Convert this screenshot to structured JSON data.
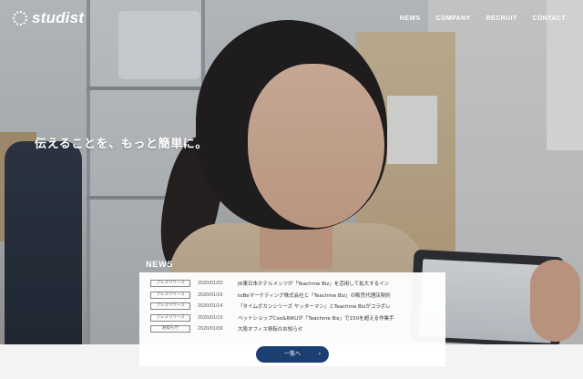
{
  "brand": {
    "logo_text": "studist"
  },
  "nav": {
    "items": [
      "NEWS",
      "COMPANY",
      "RECRUIT",
      "CONTACT"
    ]
  },
  "hero": {
    "tagline": "伝えることを、もっと簡単に。"
  },
  "news": {
    "heading": "NEWS",
    "items": [
      {
        "category": "プレスリリース",
        "date": "2020/01/20",
        "title": "JR東日本ホテルメッツが「Teachme Biz」を活用して拡大するイン"
      },
      {
        "category": "プレスリリース",
        "date": "2020/01/16",
        "title": "toBeマーケティング株式会社と「Teachme Biz」の販売代理店契約"
      },
      {
        "category": "プレスリリース",
        "date": "2020/01/14",
        "title": "『タイムボカンシリーズ ヤッターマン』とTeachme Bizがコラボレ"
      },
      {
        "category": "プレスリリース",
        "date": "2020/01/10",
        "title": "ペットショップCoo&RIKUが「Teachme Biz」で150を超える作業手"
      },
      {
        "category": "お知らせ",
        "date": "2020/01/09",
        "title": "大阪オフィス移転のお知らせ"
      }
    ],
    "more_label": "一覧へ",
    "more_icon": "chevron-right-icon"
  },
  "colors": {
    "button": "#1c3f72",
    "text_light": "#ffffff"
  }
}
